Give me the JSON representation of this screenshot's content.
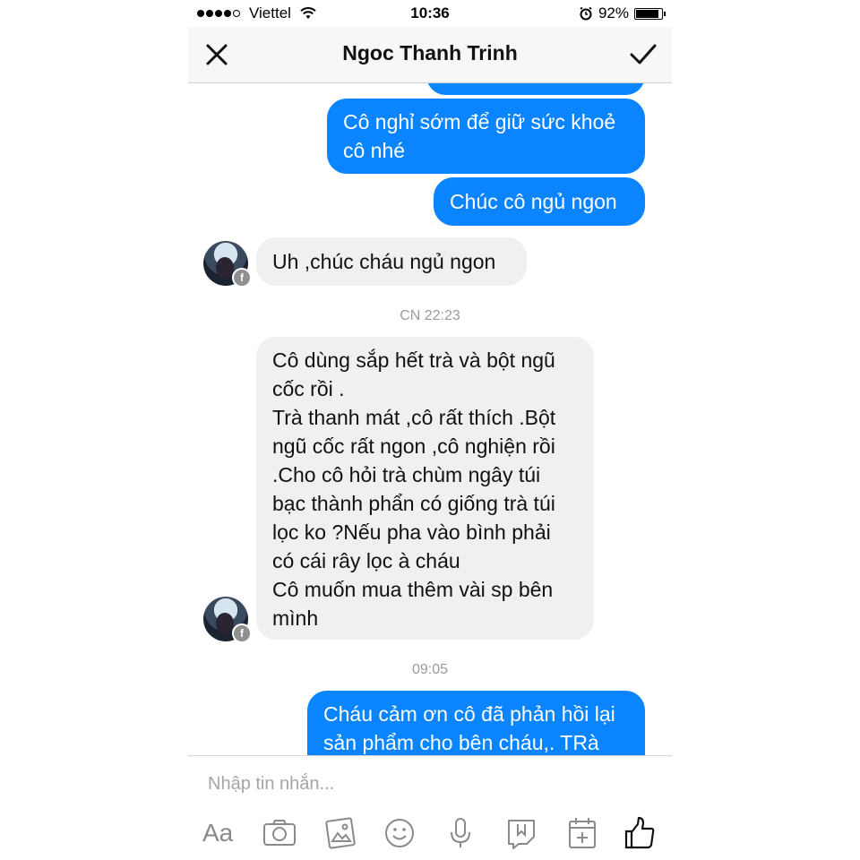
{
  "status_bar": {
    "carrier": "Viettel",
    "time": "10:36",
    "battery_percent": "92%",
    "battery_level": 0.92,
    "icons": [
      "signal-dots",
      "wifi-icon",
      "alarm-icon",
      "battery-icon"
    ]
  },
  "header": {
    "title": "Ngoc Thanh Trinh",
    "left_icon": "close-icon",
    "right_icon": "check-icon"
  },
  "messages": [
    {
      "side": "out",
      "text": "Cô nghỉ sớm để giữ sức khoẻ cô nhé"
    },
    {
      "side": "out",
      "text": "Chúc cô ngủ ngon"
    },
    {
      "side": "in",
      "text": "Uh ,chúc cháu ngủ ngon"
    },
    {
      "type": "timestamp",
      "text": "CN 22:23"
    },
    {
      "side": "in",
      "lines": [
        "Cô dùng sắp hết trà và bột ngũ",
        "cốc rồi .",
        "Trà thanh mát ,cô rất thích .Bột",
        "ngũ cốc rất ngon ,cô nghiện rồi",
        ".Cho cô hỏi trà chùm ngây túi",
        "bạc thành phẩn có giống trà túi",
        "lọc ko ?Nếu pha vào bình phải",
        "có cái rây lọc à cháu",
        "Cô muốn mua thêm vài sp bên",
        "mình"
      ]
    },
    {
      "type": "timestamp",
      "text": "09:05"
    },
    {
      "side": "out",
      "lines": [
        "Cháu cảm ơn cô đã phản hồi lại",
        "sản phẩm cho bên cháu,. TRà"
      ]
    }
  ],
  "composer": {
    "placeholder": "Nhập tin nhắn...",
    "tools": [
      "Aa",
      "camera-icon",
      "gallery-icon",
      "emoji-icon",
      "microphone-icon",
      "sticker-icon",
      "calendar-plus-icon",
      "thumbs-up-icon"
    ]
  },
  "colors": {
    "outgoing_bubble": "#0a84ff",
    "incoming_bubble": "#f1f0f0",
    "timestamp": "#9b9b9b"
  }
}
